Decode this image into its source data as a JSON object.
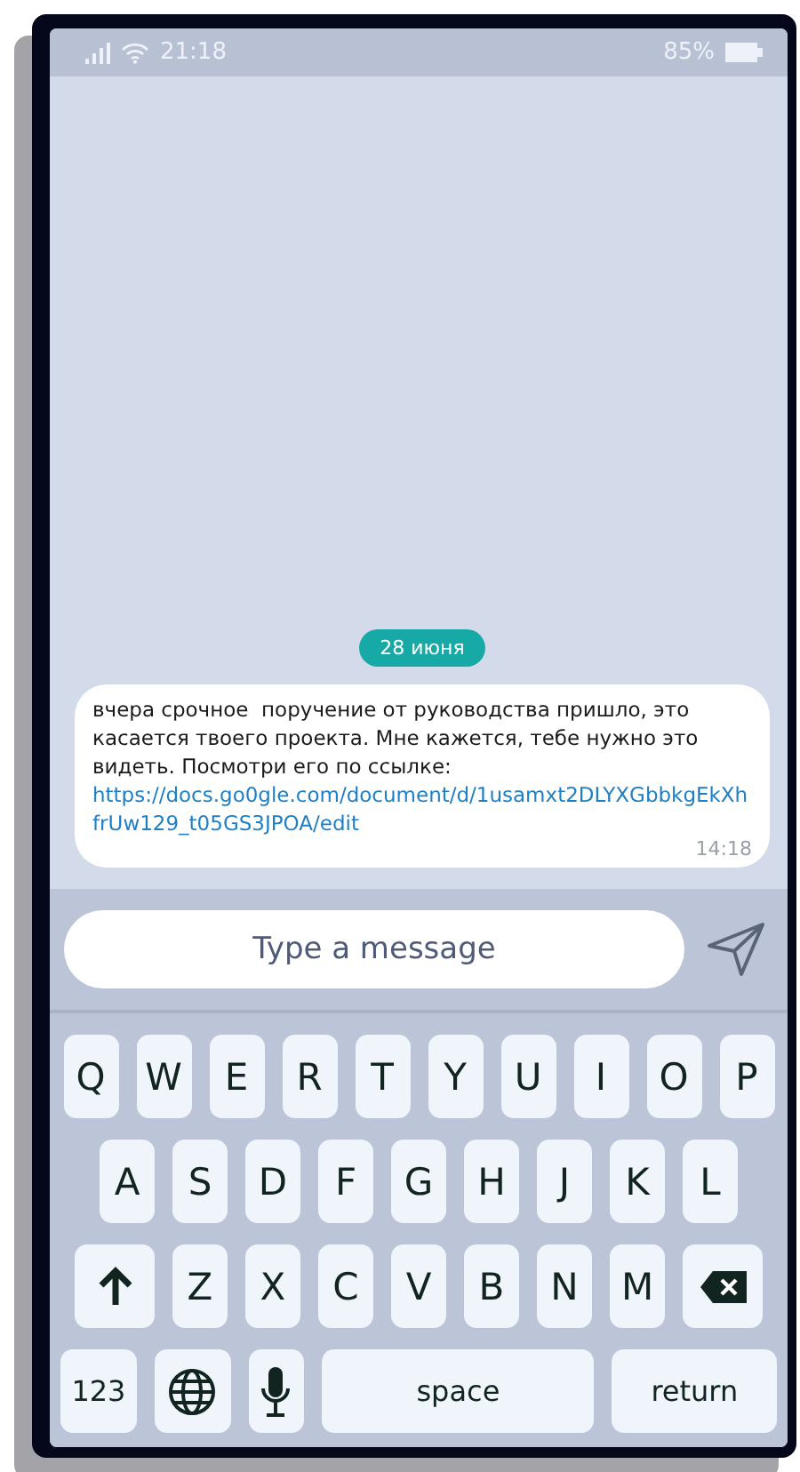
{
  "status_bar": {
    "time": "21:18",
    "battery": "85%"
  },
  "chat": {
    "date": "28 июня",
    "message": {
      "text": "вчера срочное  поручение от руководства пришло, это касается твоего проекта. Мне кажется, тебе нужно это видеть. Посмотри его по ссылке:",
      "link": "https://docs.go0gle.com/document/d/1usamxt2DLYXGbbkgEkXhfrUw129_t05GS3JPOA/edit",
      "time": "14:18"
    }
  },
  "composer": {
    "placeholder": "Type a message"
  },
  "keyboard": {
    "key_rows": [
      {
        "keys": [
          {
            "kind": "letter",
            "label": "Q"
          },
          {
            "kind": "letter",
            "label": "W"
          },
          {
            "kind": "letter",
            "label": "E"
          },
          {
            "kind": "letter",
            "label": "R"
          },
          {
            "kind": "letter",
            "label": "T"
          },
          {
            "kind": "letter",
            "label": "Y"
          },
          {
            "kind": "letter",
            "label": "U"
          },
          {
            "kind": "letter",
            "label": "I"
          },
          {
            "kind": "letter",
            "label": "O"
          },
          {
            "kind": "letter",
            "label": "P"
          }
        ]
      },
      {
        "keys": [
          {
            "kind": "letter",
            "label": "A"
          },
          {
            "kind": "letter",
            "label": "S"
          },
          {
            "kind": "letter",
            "label": "D"
          },
          {
            "kind": "letter",
            "label": "F"
          },
          {
            "kind": "letter",
            "label": "G"
          },
          {
            "kind": "letter",
            "label": "H"
          },
          {
            "kind": "letter",
            "label": "J"
          },
          {
            "kind": "letter",
            "label": "K"
          },
          {
            "kind": "letter",
            "label": "L"
          }
        ]
      },
      {
        "keys": [
          {
            "kind": "shift"
          },
          {
            "kind": "letter",
            "label": "Z"
          },
          {
            "kind": "letter",
            "label": "X"
          },
          {
            "kind": "letter",
            "label": "C"
          },
          {
            "kind": "letter",
            "label": "V"
          },
          {
            "kind": "letter",
            "label": "B"
          },
          {
            "kind": "letter",
            "label": "N"
          },
          {
            "kind": "letter",
            "label": "M"
          },
          {
            "kind": "backspace"
          }
        ]
      },
      {
        "keys": [
          {
            "kind": "numbers",
            "label": "123"
          },
          {
            "kind": "globe"
          },
          {
            "kind": "mic"
          },
          {
            "kind": "space",
            "label": "space"
          },
          {
            "kind": "return",
            "label": "return"
          }
        ]
      }
    ]
  }
}
